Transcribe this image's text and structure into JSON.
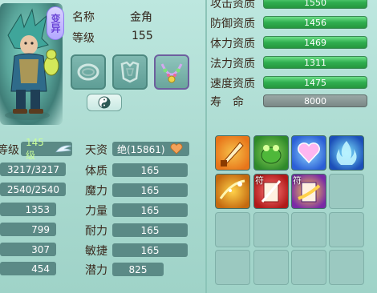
{
  "character": {
    "variant_badge": "变异",
    "name_label": "名称",
    "name_value": "金角",
    "level_label": "等级",
    "level_value": "155"
  },
  "aptitudes": [
    {
      "label": "攻击资质",
      "value": "1550"
    },
    {
      "label": "防御资质",
      "value": "1456"
    },
    {
      "label": "体力资质",
      "value": "1469"
    },
    {
      "label": "法力资质",
      "value": "1311"
    },
    {
      "label": "速度资质",
      "value": "1475"
    },
    {
      "label": "寿　命",
      "value": "8000"
    }
  ],
  "stats_left": {
    "level_label": "等级",
    "level_value": "145级",
    "rows": [
      "3217/3217",
      "2540/2540",
      "1353",
      "799",
      "307",
      "454"
    ]
  },
  "attributes": {
    "talent_label": "天资",
    "talent_value": "绝(15861)",
    "rows": [
      {
        "label": "体质",
        "value": "165"
      },
      {
        "label": "魔力",
        "value": "165"
      },
      {
        "label": "力量",
        "value": "165"
      },
      {
        "label": "耐力",
        "value": "165"
      },
      {
        "label": "敏捷",
        "value": "165"
      },
      {
        "label": "潜力",
        "value": "825"
      }
    ]
  },
  "skills": {
    "tags": [
      "符",
      "符"
    ]
  },
  "colors": {
    "apt_bar_green": "#2fae4f",
    "apt_bar_grey": "#7a8886",
    "stat_box": "#5b8a86",
    "variant_purple": "#6a44d6"
  }
}
